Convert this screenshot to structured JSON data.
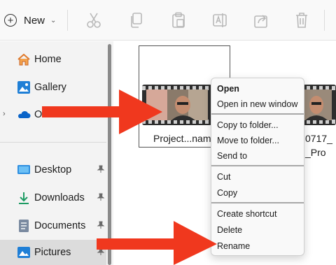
{
  "toolbar": {
    "new_label": "New",
    "new_icon": "plus-circle-icon",
    "chevron": "⌄",
    "icons": [
      "cut-icon",
      "copy-icon",
      "paste-icon",
      "rename-icon",
      "share-icon",
      "delete-icon"
    ]
  },
  "sidebar": {
    "items": [
      {
        "label": "Home",
        "icon": "home-icon"
      },
      {
        "label": "Gallery",
        "icon": "gallery-icon"
      },
      {
        "label": "OneDrive",
        "icon": "onedrive-icon"
      },
      {
        "label": "Desktop",
        "icon": "desktop-icon"
      },
      {
        "label": "Downloads",
        "icon": "downloads-icon"
      },
      {
        "label": "Documents",
        "icon": "documents-icon"
      },
      {
        "label": "Pictures",
        "icon": "pictures-icon"
      }
    ],
    "expander": "›",
    "pin_glyph": "📌"
  },
  "files": {
    "selected_label": "Project...nam",
    "other_label_line1": "0717_",
    "other_label_line2": "_Pro"
  },
  "context_menu": {
    "items": [
      "Open",
      "Open in new window",
      "Copy to folder...",
      "Move to folder...",
      "Send to",
      "Cut",
      "Copy",
      "Create shortcut",
      "Delete",
      "Rename"
    ]
  },
  "colors": {
    "arrow": "#f0381e",
    "accent": "#0067c0"
  }
}
